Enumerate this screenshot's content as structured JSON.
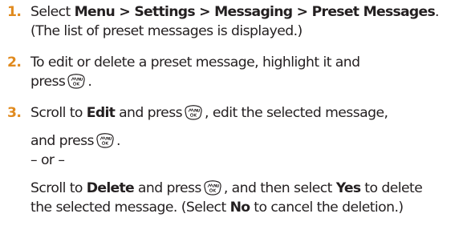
{
  "colors": {
    "step_number": "#e08a1e",
    "text": "#231f20"
  },
  "icons": {
    "menu_ok_key": "menu-ok-key-icon"
  },
  "steps": [
    {
      "number": "1.",
      "line1": {
        "pre": "Select ",
        "bold": "Menu > Settings > Messaging > Preset Messages",
        "post": "."
      },
      "line2": "(The list of preset messages is displayed.)"
    },
    {
      "number": "2.",
      "line1": "To edit or delete a preset message, highlight it and",
      "line2": {
        "pre": "press",
        "post": "."
      }
    },
    {
      "number": "3.",
      "line1": {
        "pre": "Scroll to ",
        "bold": "Edit",
        "mid": " and press",
        "post": ", edit the selected message,"
      },
      "line2": {
        "pre": "and press",
        "post": "."
      },
      "or": "– or –",
      "line3": {
        "pre": "Scroll to ",
        "bold": "Delete",
        "mid": " and press",
        "post": ", and then select ",
        "bold2": "Yes",
        "post2": " to delete"
      },
      "line4": {
        "pre": "the selected message. (Select ",
        "bold": "No",
        "post": " to cancel the deletion.)"
      }
    }
  ]
}
